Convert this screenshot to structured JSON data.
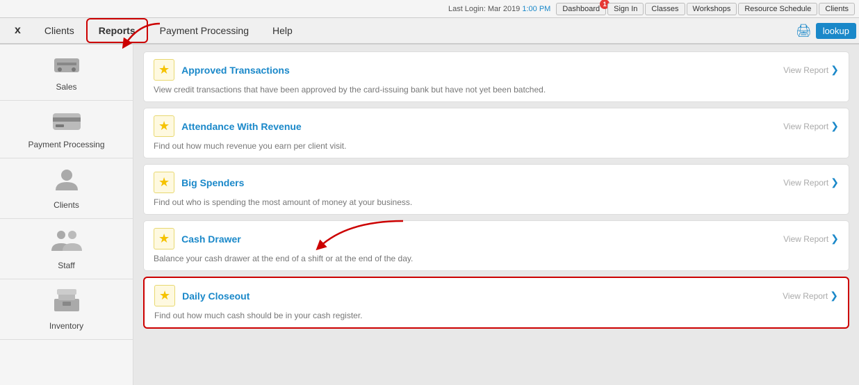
{
  "topBar": {
    "loginText": "Last Login: Mar 2019",
    "linkText": "1:00 PM",
    "buttons": [
      "Dashboard",
      "Sign In",
      "Classes",
      "Workshops",
      "Resource Schedule",
      "Clients"
    ],
    "dashboardBadge": "1"
  },
  "mainNav": {
    "items": [
      "x",
      "Clients",
      "Reports",
      "Payment Processing",
      "Help"
    ],
    "rightItems": [
      "lookup"
    ]
  },
  "sidebar": {
    "items": [
      {
        "label": "Sales",
        "icon": "💲"
      },
      {
        "label": "Payment Processing",
        "icon": "💳"
      },
      {
        "label": "Clients",
        "icon": "👤"
      },
      {
        "label": "Staff",
        "icon": "👥"
      },
      {
        "label": "Inventory",
        "icon": "📦"
      }
    ]
  },
  "reports": [
    {
      "title": "Approved Transactions",
      "description": "View credit transactions that have been approved by the card-issuing bank but have not yet been batched.",
      "viewLabel": "View Report",
      "starred": true
    },
    {
      "title": "Attendance With Revenue",
      "description": "Find out how much revenue you earn per client visit.",
      "viewLabel": "View Report",
      "starred": true
    },
    {
      "title": "Big Spenders",
      "description": "Find out who is spending the most amount of money at your business.",
      "viewLabel": "View Report",
      "starred": true
    },
    {
      "title": "Cash Drawer",
      "description": "Balance your cash drawer at the end of a shift or at the end of the day.",
      "viewLabel": "View Report",
      "starred": true
    },
    {
      "title": "Daily Closeout",
      "description": "Find out how much cash should be in your cash register.",
      "viewLabel": "View Report",
      "starred": true,
      "highlighted": true
    }
  ],
  "icons": {
    "star": "★",
    "arrow_right": "❯",
    "printer": "🖨",
    "lookup": "lookup"
  }
}
